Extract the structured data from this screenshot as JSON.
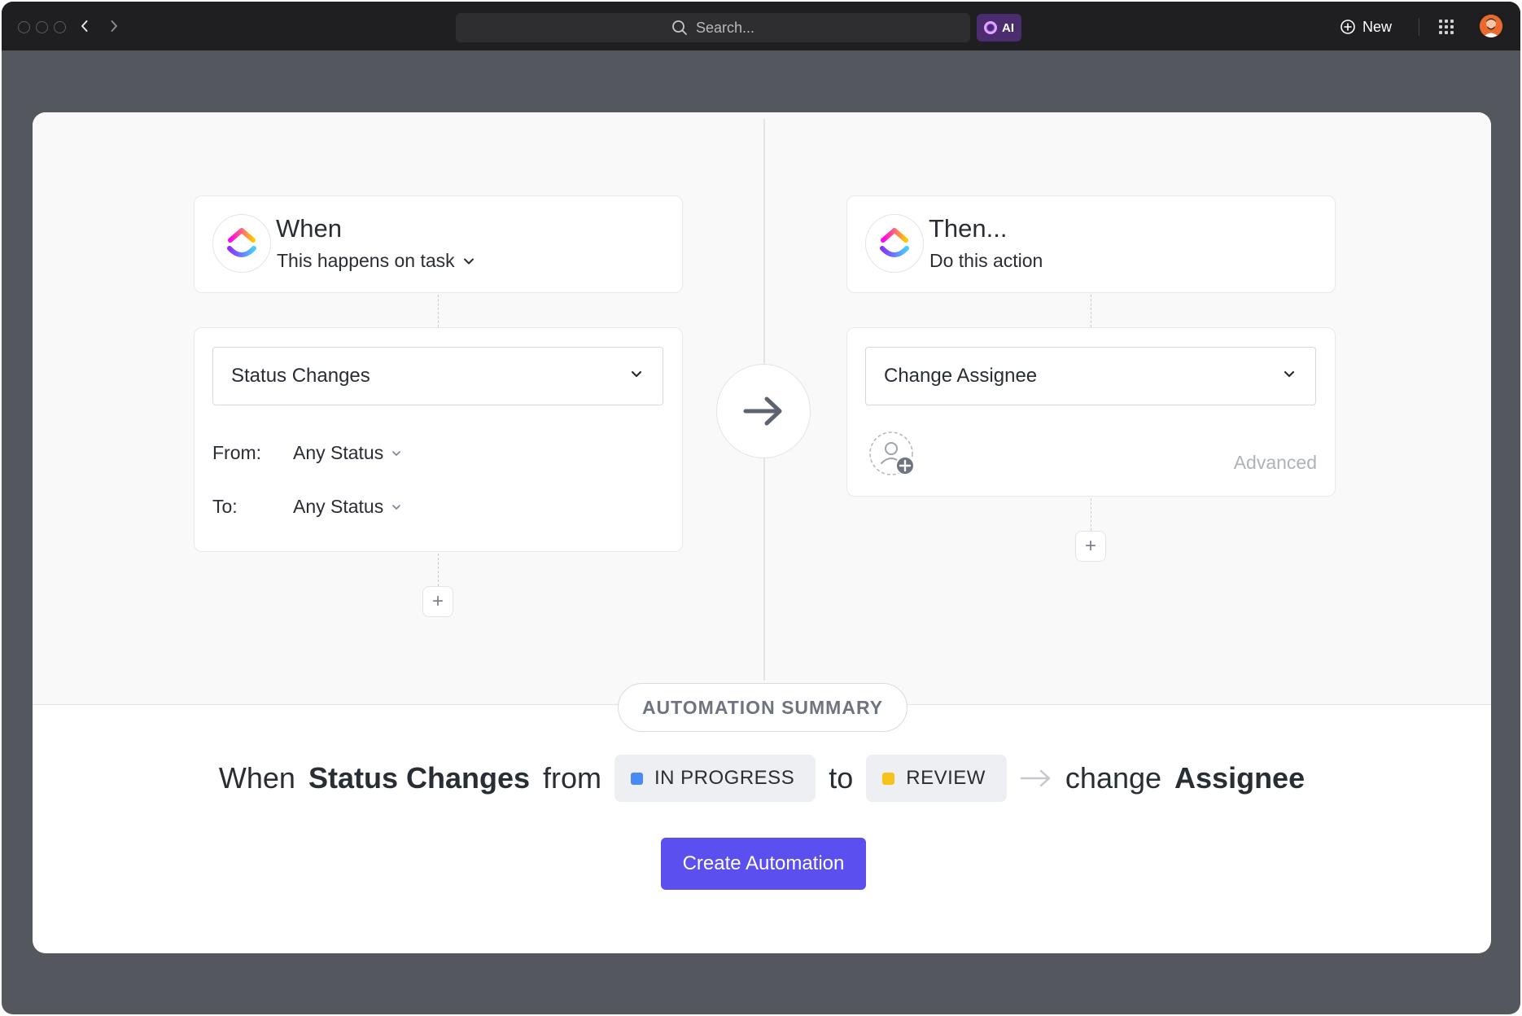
{
  "topbar": {
    "search_placeholder": "Search...",
    "ai_label": "AI",
    "new_label": "New"
  },
  "trigger": {
    "title": "When",
    "subtitle": "This happens on task",
    "select_value": "Status Changes",
    "from_label": "From:",
    "from_value": "Any Status",
    "to_label": "To:",
    "to_value": "Any Status",
    "add_label": "+"
  },
  "action": {
    "title": "Then...",
    "subtitle": "Do this action",
    "select_value": "Change Assignee",
    "advanced_label": "Advanced",
    "add_label": "+"
  },
  "summary": {
    "label": "AUTOMATION SUMMARY",
    "when": "When",
    "trigger": "Status Changes",
    "from": "from",
    "from_status": "IN PROGRESS",
    "from_status_color": "#4a8af4",
    "to": "to",
    "to_status": "REVIEW",
    "to_status_color": "#f7c21b",
    "change": "change",
    "target": "Assignee"
  },
  "create_button_label": "Create Automation",
  "colors": {
    "accent": "#5b4ff0",
    "topbar": "#1f1f21",
    "backdrop": "#55575f"
  }
}
